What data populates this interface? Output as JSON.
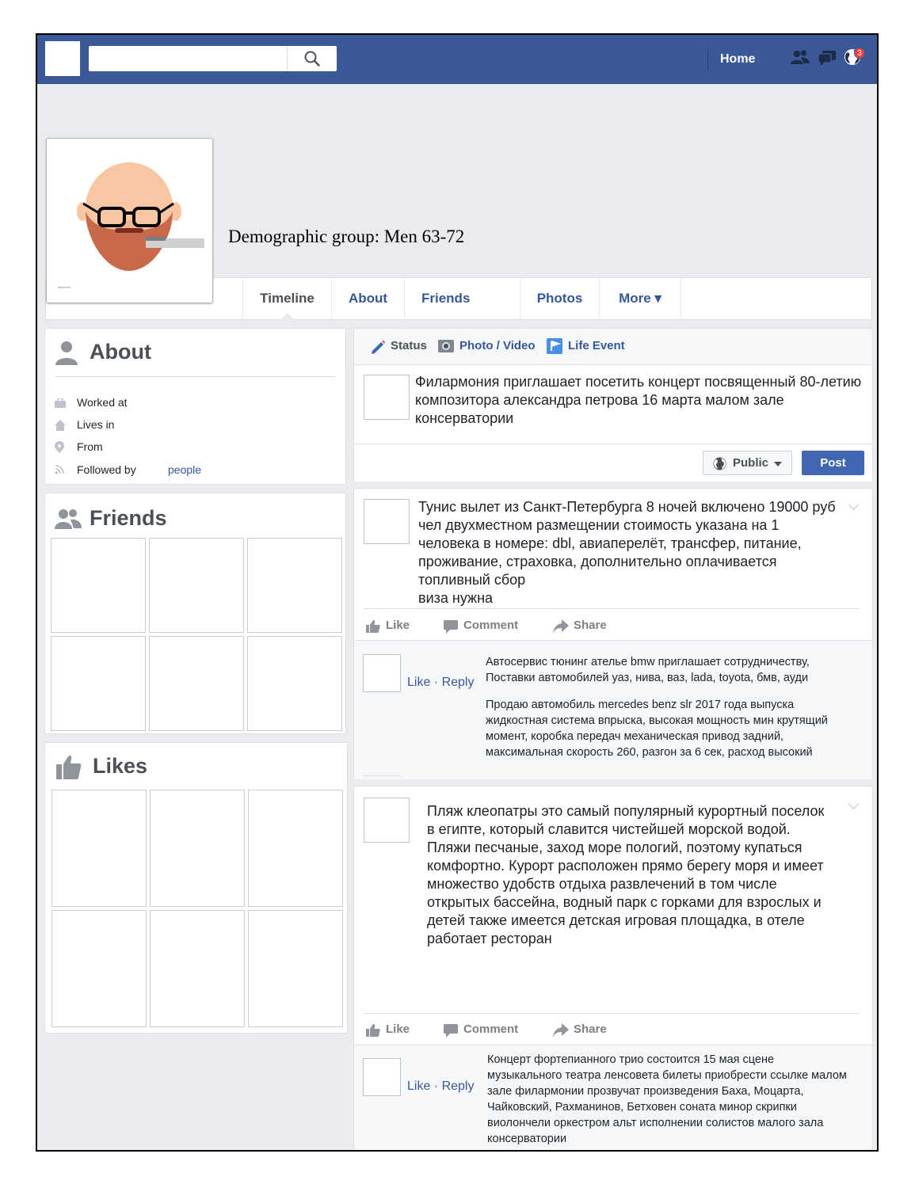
{
  "topbar": {
    "search_placeholder": "",
    "home_label": "Home",
    "notification_count": "3",
    "brand_color": "#3b5998"
  },
  "profile": {
    "demographic": "Demographic group: Men 63-72"
  },
  "tabs": [
    {
      "label": "Timeline",
      "active": true
    },
    {
      "label": "About"
    },
    {
      "label": "Friends"
    },
    {
      "label": "Photos"
    },
    {
      "label": "More ▾"
    }
  ],
  "about": {
    "title": "About",
    "rows": [
      {
        "icon": "briefcase-icon",
        "label": "Worked at"
      },
      {
        "icon": "home-icon",
        "label": "Lives in"
      },
      {
        "icon": "location-pin-icon",
        "label": "From"
      },
      {
        "icon": "rss-icon",
        "label": "Followed by",
        "link": "people"
      }
    ]
  },
  "friends": {
    "title": "Friends"
  },
  "likes": {
    "title": "Likes"
  },
  "composer": {
    "tabs": [
      "Status",
      "Photo / Video",
      "Life Event"
    ],
    "text": "Филармония приглашает посетить концерт посвященный 80-летию композитора александра петрова 16 марта малом зале консерватории",
    "privacy_label": "Public",
    "post_label": "Post"
  },
  "posts": [
    {
      "text": "Тунис вылет из Санкт-Петербурга 8 ночей включено 19000 руб чел двухместном размещении стоимость указана на 1 человека в номере: dbl, авиаперелёт, трансфер, питание, проживание, страховка, дополнительно оплачивается топливный сбор\n виза нужна",
      "actions": [
        "Like",
        "Comment",
        "Share"
      ],
      "comment_actions": "Like · Reply",
      "comments": [
        "Автосервис тюнинг ателье bmw приглашает сотрудничеству, Поставки автомобилей уаз, нива, ваз, lada, toyota, бмв, ауди",
        "Продаю автомобиль mercedes benz slr 2017 года выпуска жидкостная система впрыска, высокая мощность мин крутящий момент, коробка передач механическая привод задний, максимальная скорость 260, разгон за 6 сек, расход высокий"
      ]
    },
    {
      "text": "Пляж клеопатры это самый популярный курортный поселок в египте, который славится чистейшей морской водой. Пляжи песчаные, заход море пологий, поэтому купаться комфортно. Курорт расположен прямо берегу моря и имеет множество удобств отдыха развлечений в том числе открытых бассейна, водный парк с горками для взрослых и детей также имеется детская игровая площадка, в отеле работает ресторан",
      "actions": [
        "Like",
        "Comment",
        "Share"
      ],
      "comment_actions": "Like · Reply",
      "comments": [
        "Концерт фортепианного трио состоится 15 мая сцене музыкального театра ленсовета билеты приобрести ссылке малом зале филармонии прозвучат произведения Баха, Моцарта, Чайковский, Рахманинов, Бетховен соната минор скрипки виолончели оркестром альт исполнении солистов малого зала консерватории"
      ]
    }
  ]
}
